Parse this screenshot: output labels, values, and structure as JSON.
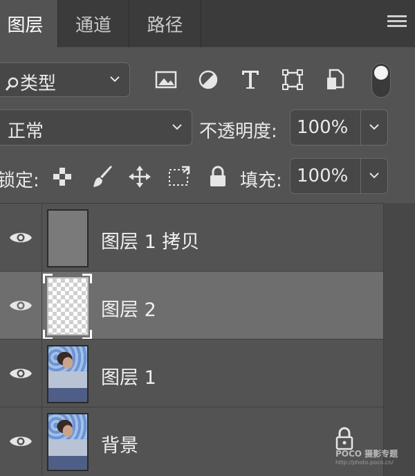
{
  "tabs": [
    {
      "label": "图层",
      "active": true
    },
    {
      "label": "通道",
      "active": false
    },
    {
      "label": "路径",
      "active": false
    }
  ],
  "filter": {
    "label": "类型"
  },
  "filter_icons": [
    "image-filter-icon",
    "adjustment-filter-icon",
    "type-filter-icon",
    "shape-filter-icon",
    "smart-object-filter-icon"
  ],
  "blend_mode": "正常",
  "opacity": {
    "label": "不透明度:",
    "value": "100%"
  },
  "lock": {
    "label": "锁定:",
    "icons": [
      "lock-transparent-pixels-icon",
      "lock-image-pixels-icon",
      "lock-position-icon",
      "prevent-autonest-icon",
      "lock-all-icon"
    ]
  },
  "fill": {
    "label": "填充:",
    "value": "100%"
  },
  "layers": [
    {
      "name": "图层 1 拷贝",
      "thumb": "gray",
      "selected": false
    },
    {
      "name": "图层 2",
      "thumb": "transparent",
      "selected": true
    },
    {
      "name": "图层 1",
      "thumb": "photo",
      "selected": false
    },
    {
      "name": "背景",
      "thumb": "photo",
      "selected": false,
      "locked": true
    }
  ],
  "watermark": {
    "line1": "POCO 摄影专题",
    "line2": "http://photo.poco.cn/"
  },
  "colors": {
    "panel": "#535353",
    "tabbar": "#3b3b3b",
    "selected_row": "#6e6e6e"
  }
}
